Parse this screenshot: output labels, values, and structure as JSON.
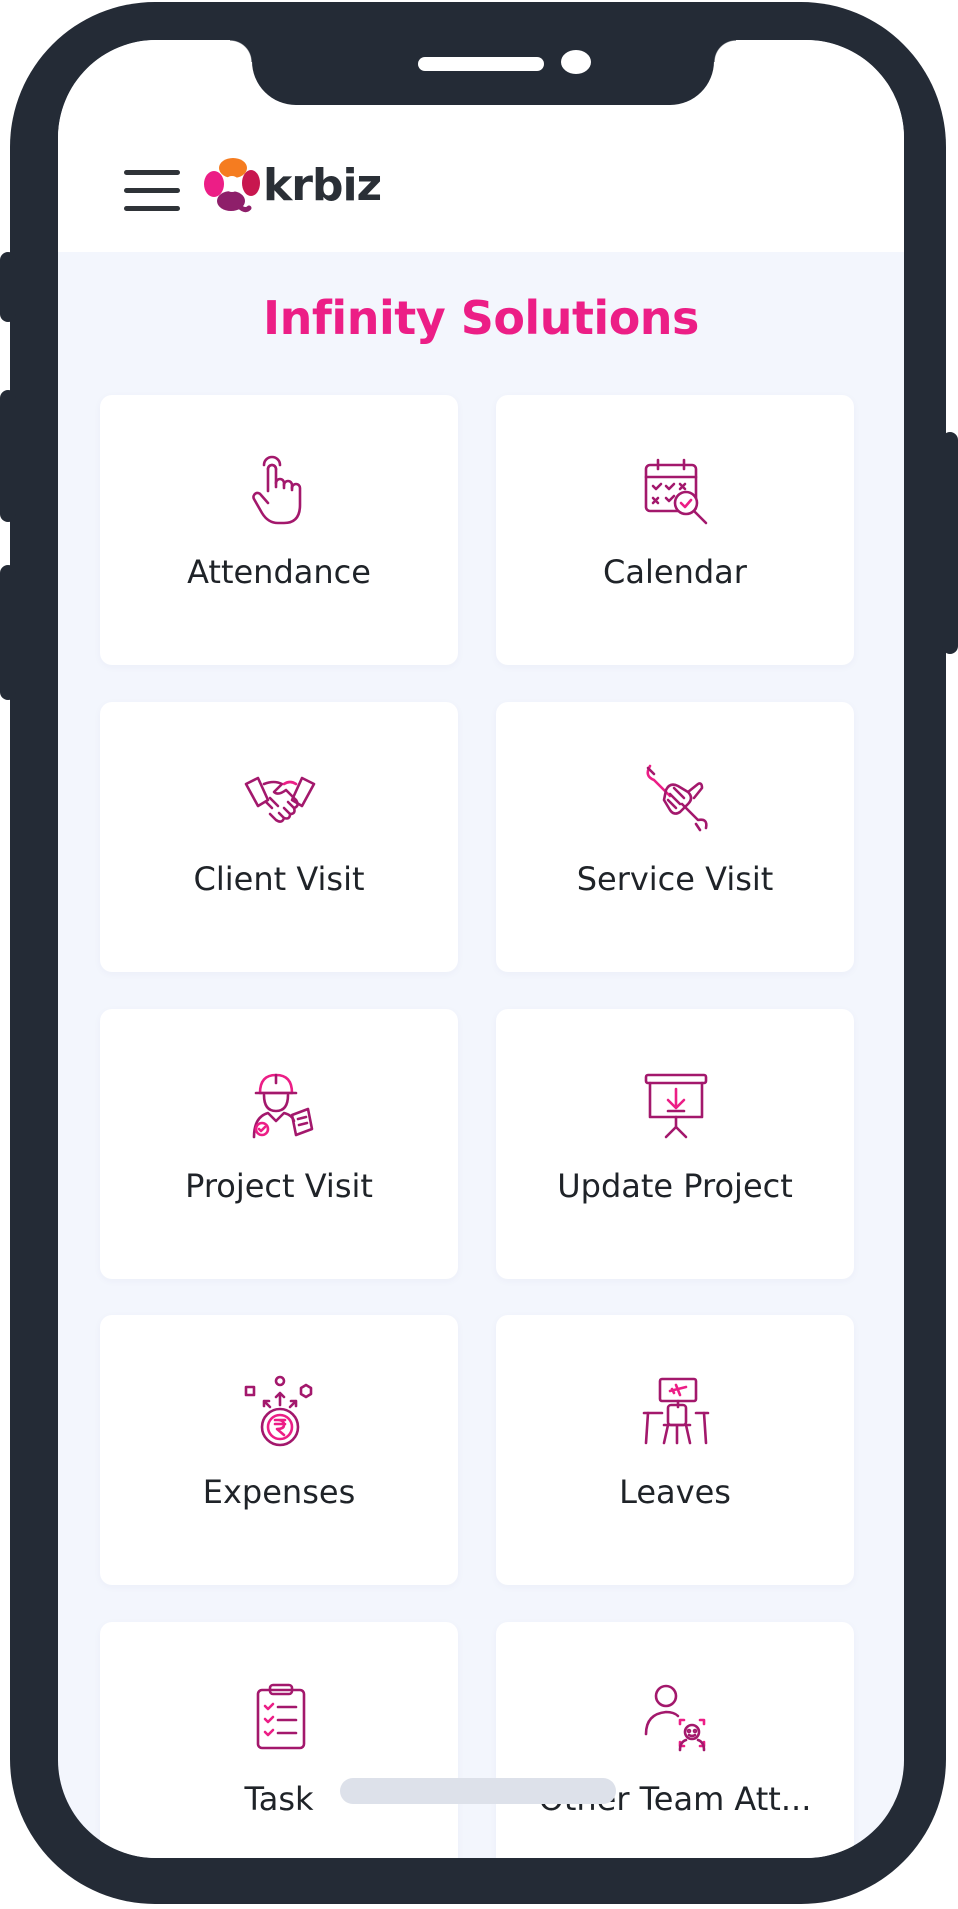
{
  "header": {
    "menu_icon": "hamburger-icon",
    "logo_text": "krbiz",
    "logo_colors": [
      "#f57c20",
      "#ec1e86",
      "#8e1f6a"
    ]
  },
  "company_name": "Infinity Solutions",
  "accent_color": "#ec1e86",
  "tiles": [
    {
      "label": "Attendance",
      "icon": "tap-finger-icon"
    },
    {
      "label": "Calendar",
      "icon": "calendar-search-icon"
    },
    {
      "label": "Client Visit",
      "icon": "handshake-icon"
    },
    {
      "label": "Service Visit",
      "icon": "wrench-hand-icon"
    },
    {
      "label": "Project Visit",
      "icon": "engineer-icon"
    },
    {
      "label": "Update Project",
      "icon": "presentation-board-icon"
    },
    {
      "label": "Expenses",
      "icon": "rupee-coin-icon"
    },
    {
      "label": "Leaves",
      "icon": "desk-flight-icon"
    },
    {
      "label": "Task",
      "icon": "checklist-icon"
    },
    {
      "label": "Other Team Att...",
      "icon": "team-face-scan-icon"
    }
  ]
}
